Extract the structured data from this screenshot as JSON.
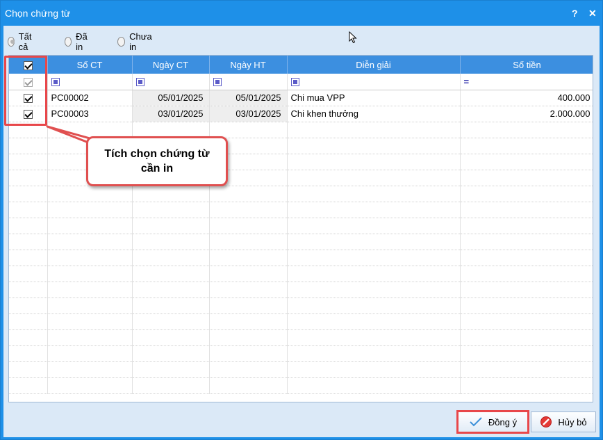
{
  "window": {
    "title": "Chọn chứng từ",
    "help_label": "?",
    "close_label": "✕"
  },
  "filter_radios": [
    {
      "label": "Tất cả",
      "selected": true
    },
    {
      "label": "Đã in",
      "selected": false
    },
    {
      "label": "Chưa in",
      "selected": false
    }
  ],
  "grid": {
    "columns": [
      "",
      "Số CT",
      "Ngày CT",
      "Ngày HT",
      "Diễn giải",
      "Số tiền"
    ],
    "rows": [
      {
        "checked": true,
        "so_ct": "PC00002",
        "ngay_ct": "05/01/2025",
        "ngay_ht": "05/01/2025",
        "dien_giai": "Chi mua VPP",
        "so_tien": "400.000"
      },
      {
        "checked": true,
        "so_ct": "PC00003",
        "ngay_ct": "03/01/2025",
        "ngay_ht": "03/01/2025",
        "dien_giai": "Chi khen thưởng",
        "so_tien": "2.000.000"
      }
    ]
  },
  "callout": {
    "text": "Tích chọn chứng từ cần in"
  },
  "buttons": {
    "ok_label": "Đồng ý",
    "cancel_label": "Hủy bỏ"
  },
  "colors": {
    "accent": "#1e90e8",
    "header": "#3c8fe0",
    "highlight": "#e8474a"
  }
}
